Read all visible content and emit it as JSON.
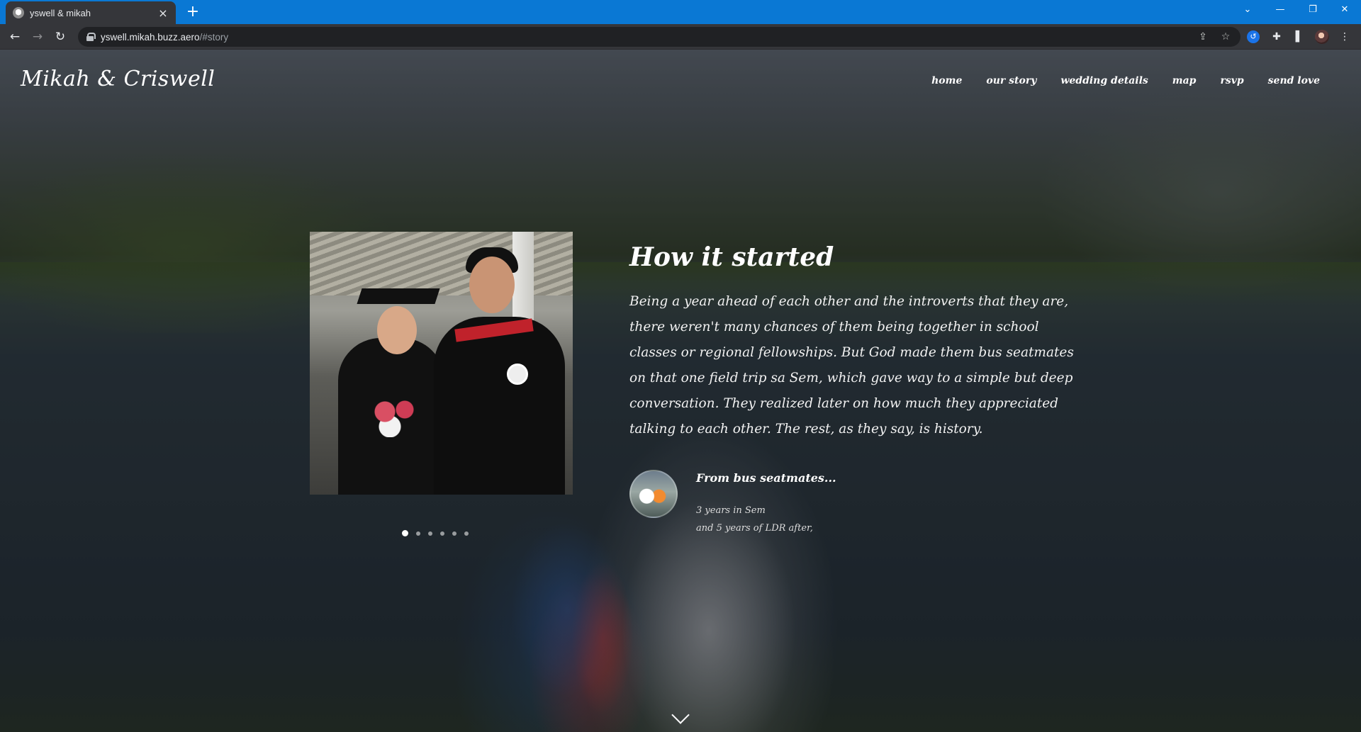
{
  "browser": {
    "tab_title": "yswell & mikah",
    "tab_close": "×",
    "new_tab": "+",
    "url_host": "yswell.mikah.buzz.aero",
    "url_path": "/#story",
    "controls": {
      "tabsearch": "⌄",
      "minimize": "—",
      "restore": "❐",
      "close": "✕"
    },
    "nav": {
      "back": "←",
      "forward": "→",
      "reload": "↻"
    },
    "omni_icons": {
      "share": "⇪",
      "bookmark": "☆"
    },
    "extensions": {
      "ext1": "↺",
      "puzzle": "✚",
      "sidepanel": "▌",
      "menu": "⋮"
    }
  },
  "site": {
    "brand": "Mikah & Criswell",
    "nav": [
      "home",
      "our story",
      "wedding details",
      "map",
      "rsvp",
      "send love"
    ]
  },
  "story": {
    "heading": "How it started",
    "body": "Being a year ahead of each other and the introverts that they are, there weren't many chances of them being together in school classes or regional fellowships. But God made them bus seatmates on that one field trip sa Sem, which gave way to a simple but deep conversation. They realized later on how much they appreciated talking to each other. The rest, as they say, is history.",
    "slides_total": 6,
    "active_slide": 1
  },
  "timeline": {
    "title": "From bus seatmates...",
    "line1": "3 years in Sem",
    "line2": "and 5 years of LDR after,"
  }
}
